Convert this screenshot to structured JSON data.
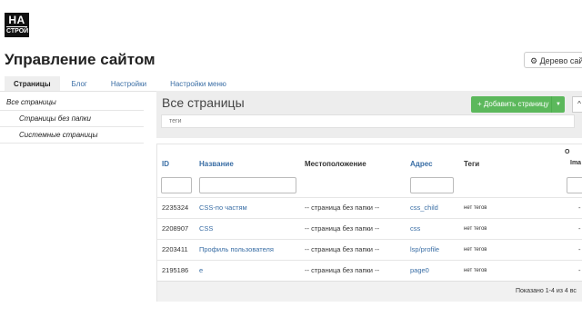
{
  "logo": {
    "line1": "НА",
    "line2": "СТРОЙ"
  },
  "page_title": "Управление сайтом",
  "tree_button": {
    "icon": "gear-icon",
    "label": "⚙ Дерево сайта"
  },
  "tabs": [
    {
      "label": "Страницы",
      "active": true
    },
    {
      "label": "Блог",
      "active": false
    },
    {
      "label": "Настройки",
      "active": false
    },
    {
      "label": "Настройки меню",
      "active": false
    }
  ],
  "sidebar": {
    "items": [
      {
        "label": "Все страницы"
      },
      {
        "label": "Страницы без папки"
      },
      {
        "label": "Системные страницы"
      }
    ]
  },
  "main": {
    "title": "Все страницы",
    "add_button": "+ Добавить страницу",
    "up_button": "^",
    "tags_placeholder": "теги"
  },
  "table": {
    "columns": {
      "id": "ID",
      "name": "Название",
      "location": "Местоположение",
      "address": "Адрес",
      "tags": "Теги",
      "overflow_top": "О",
      "overflow_bottom": "Ima"
    },
    "rows": [
      {
        "id": "2235324",
        "name": "CSS-по частям",
        "location": "-- страница без папки --",
        "address": "css_child",
        "tags": "нет тегов",
        "extra": "-"
      },
      {
        "id": "2208907",
        "name": "CSS",
        "location": "-- страница без папки --",
        "address": "css",
        "tags": "нет тегов",
        "extra": "-"
      },
      {
        "id": "2203411",
        "name": "Профиль пользователя",
        "location": "-- страница без папки --",
        "address": "lsp/profile",
        "tags": "нет тегов",
        "extra": "-"
      },
      {
        "id": "2195186",
        "name": "e",
        "location": "-- страница без папки --",
        "address": "page0",
        "tags": "нет тегов",
        "extra": "-"
      }
    ],
    "footer": "Показано 1-4 из 4 вс"
  },
  "colors": {
    "accent_link": "#3a6ea5",
    "add_button": "#5cb85c",
    "panel_bg": "#ededed"
  }
}
